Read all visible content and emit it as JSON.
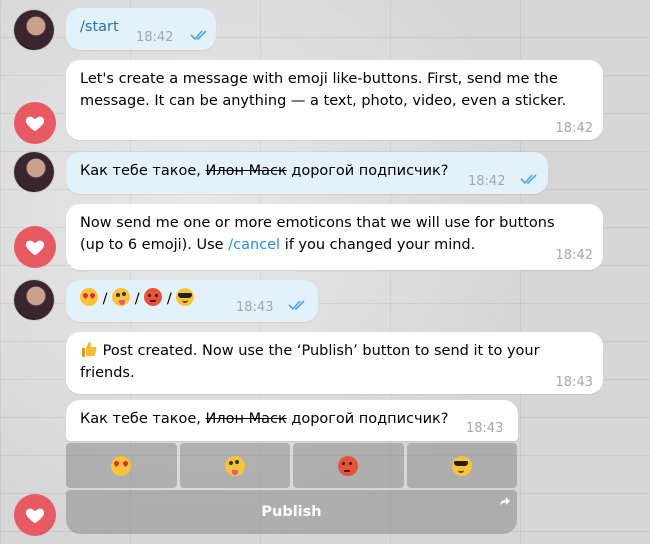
{
  "messages": [
    {
      "id": "m1",
      "text": "/start",
      "time": "18:42"
    },
    {
      "id": "m2",
      "text_line1": "Let's create a message with emoji like-buttons. First, send me the",
      "text_line2": "message. It can be anything — a text, photo, video, even a sticker.",
      "time": "18:42"
    },
    {
      "id": "m3",
      "prefix": "Как тебе такое,",
      "strike": "Илон Маск",
      "suffix": "дорогой подписчик?",
      "time": "18:42"
    },
    {
      "id": "m4",
      "text_line1": "Now send me one or more emoticons that we will use for buttons",
      "prefix2": "(up to 6 emoji). Use",
      "link": "/cancel",
      "suffix2": "if you changed your mind.",
      "time": "18:42"
    },
    {
      "id": "m5",
      "separator": "/",
      "emojis": [
        "heart-eyes-emoji",
        "zany-face-emoji",
        "angry-face-emoji",
        "sunglasses-face-emoji"
      ],
      "time": "18:43"
    },
    {
      "id": "m6",
      "text_line1": "Post created. Now use the ‘Publish’ button to send it to your",
      "text_line2": "friends.",
      "time": "18:43"
    },
    {
      "id": "m7",
      "prefix": "Как тебе такое,",
      "strike": "Илон Маск",
      "suffix": "дорогой подписчик?",
      "time": "18:43"
    }
  ],
  "reaction_buttons": [
    "heart-eyes-emoji",
    "zany-face-emoji",
    "angry-face-emoji",
    "sunglasses-face-emoji"
  ],
  "publish_label": "Publish",
  "colors": {
    "outgoing_bubble": "#e3f1fb",
    "incoming_bubble": "#ffffff",
    "bot_avatar": "#e85a63",
    "link": "#2b8ad4",
    "read_checks": "#4fa3e0"
  }
}
